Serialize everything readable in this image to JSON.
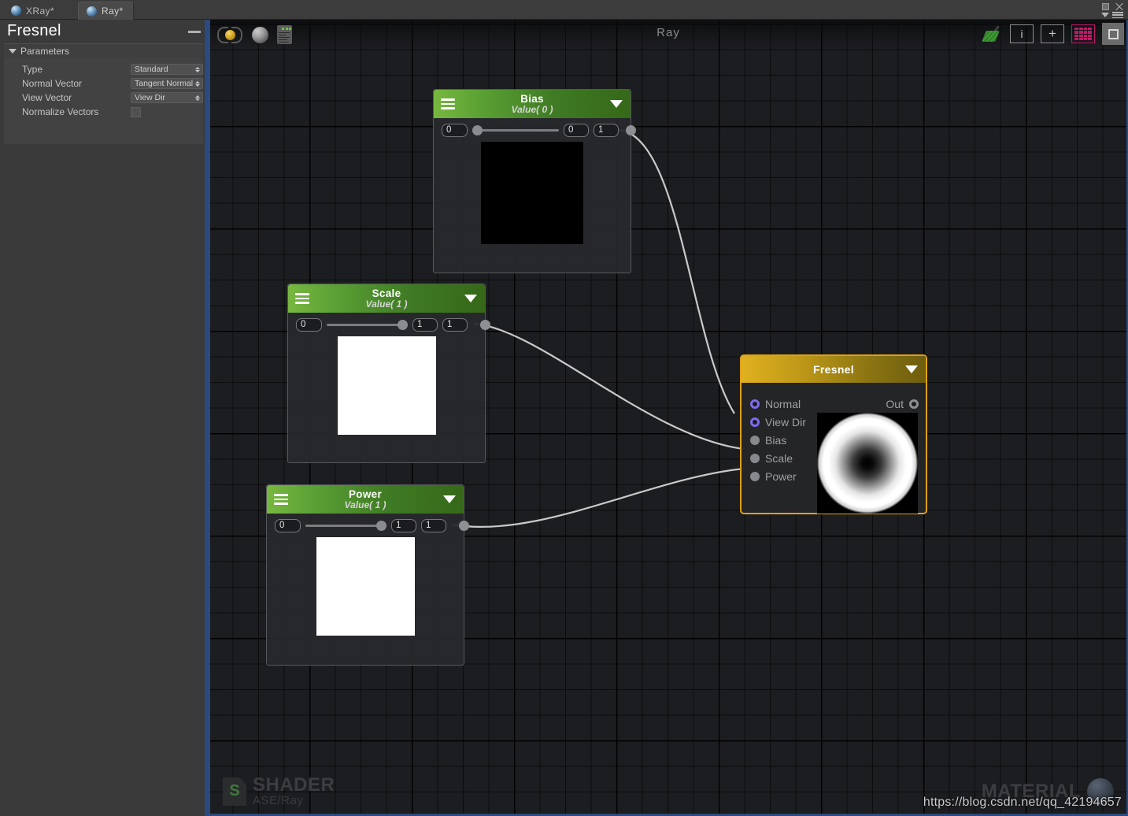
{
  "window": {
    "tabs": [
      {
        "label": "XRay*",
        "active": false
      },
      {
        "label": "Ray*",
        "active": true
      }
    ],
    "controls": {
      "maximize": "maximize-icon",
      "close": "close-icon",
      "menu": "menu-icon"
    }
  },
  "inspector": {
    "title": "Fresnel",
    "minimize_label": "—",
    "section": "Parameters",
    "rows": [
      {
        "label": "Type",
        "control": "dropdown",
        "value": "Standard"
      },
      {
        "label": "Normal Vector",
        "control": "dropdown",
        "value": "Tangent Normal"
      },
      {
        "label": "View Vector",
        "control": "dropdown",
        "value": "View Dir"
      },
      {
        "label": "Normalize Vectors",
        "control": "checkbox",
        "value": ""
      }
    ]
  },
  "toolbar": {
    "title": "Ray",
    "left_icons": [
      {
        "name": "live-update-icon",
        "label": ""
      },
      {
        "name": "preview-sphere-icon",
        "label": ""
      },
      {
        "name": "shader-code-icon",
        "label": ""
      }
    ],
    "right_icons": [
      {
        "name": "cleanup-broom-icon",
        "label": ""
      },
      {
        "name": "info-icon",
        "label": "i"
      },
      {
        "name": "add-node-icon",
        "label": "+"
      },
      {
        "name": "grid-toggle-icon",
        "label": ""
      },
      {
        "name": "focus-icon",
        "label": ""
      }
    ],
    "accent_pink": "#c0186a",
    "accent_green": "#3f9b35"
  },
  "nodes": [
    {
      "id": "bias",
      "title": "Bias",
      "subtitle": "Value( 0 )",
      "header_color": "#5ca235",
      "fields": {
        "left": "0",
        "mid": "0",
        "right": "1"
      },
      "slider_pct": 0,
      "preview_color": "#000000",
      "menu_icon": "hamburger-icon",
      "collapse_icon": "chevron-down-icon",
      "output_port": "output-port"
    },
    {
      "id": "scale",
      "title": "Scale",
      "subtitle": "Value( 1 )",
      "header_color": "#5ca235",
      "fields": {
        "left": "0",
        "mid": "1",
        "right": "1"
      },
      "slider_pct": 100,
      "preview_color": "#ffffff",
      "menu_icon": "hamburger-icon",
      "collapse_icon": "chevron-down-icon",
      "output_port": "output-port"
    },
    {
      "id": "power",
      "title": "Power",
      "subtitle": "Value( 1 )",
      "header_color": "#5ca235",
      "fields": {
        "left": "0",
        "mid": "1",
        "right": "1"
      },
      "slider_pct": 100,
      "preview_color": "#ffffff",
      "menu_icon": "hamburger-icon",
      "collapse_icon": "chevron-down-icon",
      "output_port": "output-port"
    }
  ],
  "fresnel_node": {
    "title": "Fresnel",
    "header_color": "#d4a916",
    "border_color": "#e0a017",
    "inputs": [
      {
        "label": "Normal",
        "port": "connected-ring",
        "color": "#7d6bf0"
      },
      {
        "label": "View Dir",
        "port": "connected-ring",
        "color": "#7d6bf0"
      },
      {
        "label": "Bias",
        "port": "filled-dot",
        "color": "#87898d"
      },
      {
        "label": "Scale",
        "port": "filled-dot",
        "color": "#87898d"
      },
      {
        "label": "Power",
        "port": "filled-dot",
        "color": "#87898d"
      }
    ],
    "output": {
      "label": "Out",
      "port": "ring",
      "color": "#8d8f93"
    },
    "collapse_icon": "chevron-down-icon",
    "preview": "fresnel-gradient-preview"
  },
  "footer": {
    "shader_label": "SHADER",
    "shader_path": "ASE/Ray",
    "shader_icon_letter": "S",
    "material_label": "MATERIAL",
    "watermark": "https://blog.csdn.net/qq_42194657"
  },
  "connections": [
    {
      "from": "bias",
      "to": "Bias"
    },
    {
      "from": "scale",
      "to": "Scale"
    },
    {
      "from": "power",
      "to": "Power"
    }
  ]
}
